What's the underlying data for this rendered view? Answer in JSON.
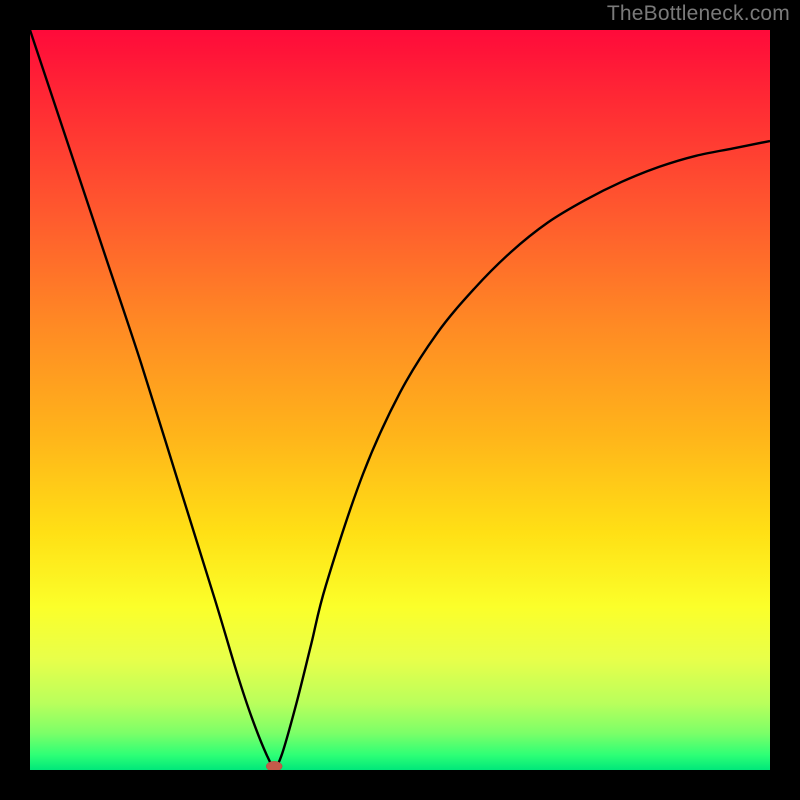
{
  "watermark": "TheBottleneck.com",
  "colors": {
    "frame": "#000000",
    "gradient_top": "#ff0a3a",
    "gradient_bottom": "#00e77a",
    "curve": "#000000",
    "marker": "#c45b4a"
  },
  "chart_data": {
    "type": "line",
    "title": "",
    "xlabel": "",
    "ylabel": "",
    "xlim": [
      0,
      100
    ],
    "ylim": [
      0,
      100
    ],
    "grid": false,
    "legend": false,
    "annotations": [
      "TheBottleneck.com"
    ],
    "marker": {
      "x": 33,
      "y": 0.5
    },
    "series": [
      {
        "name": "bottleneck-curve",
        "x": [
          0,
          5,
          10,
          15,
          20,
          25,
          28,
          30,
          32,
          33,
          34,
          36,
          38,
          40,
          45,
          50,
          55,
          60,
          65,
          70,
          75,
          80,
          85,
          90,
          95,
          100
        ],
        "y": [
          100,
          85,
          70,
          55,
          39,
          23,
          13,
          7,
          2,
          0.5,
          2,
          9,
          17,
          25,
          40,
          51,
          59,
          65,
          70,
          74,
          77,
          79.5,
          81.5,
          83,
          84,
          85
        ]
      }
    ]
  }
}
